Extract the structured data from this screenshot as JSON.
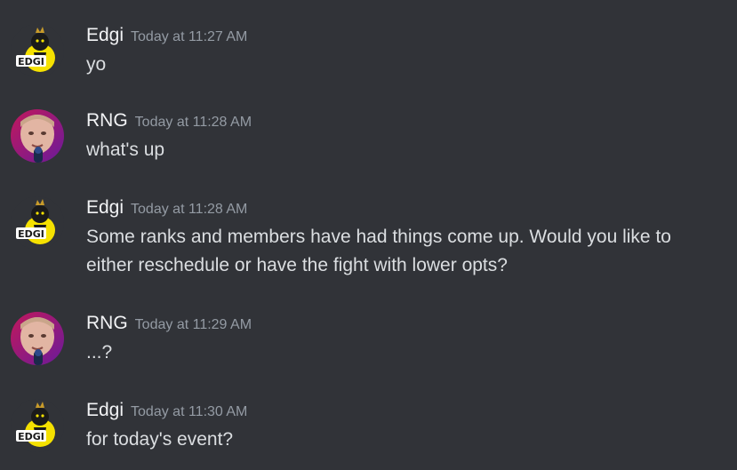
{
  "messages": [
    {
      "author": "Edgi",
      "avatar": "edgi-yellow-character-avatar",
      "timestamp": "Today at 11:27 AM",
      "lines": [
        "yo"
      ]
    },
    {
      "author": "RNG",
      "avatar": "rng-portrait-avatar",
      "timestamp": "Today at 11:28 AM",
      "lines": [
        "what's up"
      ]
    },
    {
      "author": "Edgi",
      "avatar": "edgi-yellow-character-avatar",
      "timestamp": "Today at 11:28 AM",
      "lines": [
        "Some ranks and members have had things come up. Would you like to",
        "either reschedule or have the fight with lower opts?"
      ]
    },
    {
      "author": "RNG",
      "avatar": "rng-portrait-avatar",
      "timestamp": "Today at 11:29 AM",
      "lines": [
        "...?"
      ]
    },
    {
      "author": "Edgi",
      "avatar": "edgi-yellow-character-avatar",
      "timestamp": "Today at 11:30 AM",
      "lines": [
        "for today's event?"
      ]
    }
  ],
  "avatar_label": "EDGI",
  "colors": {
    "background": "#313338",
    "username": "#f2f3f5",
    "timestamp": "#949ba4",
    "text": "#dbdee1"
  }
}
